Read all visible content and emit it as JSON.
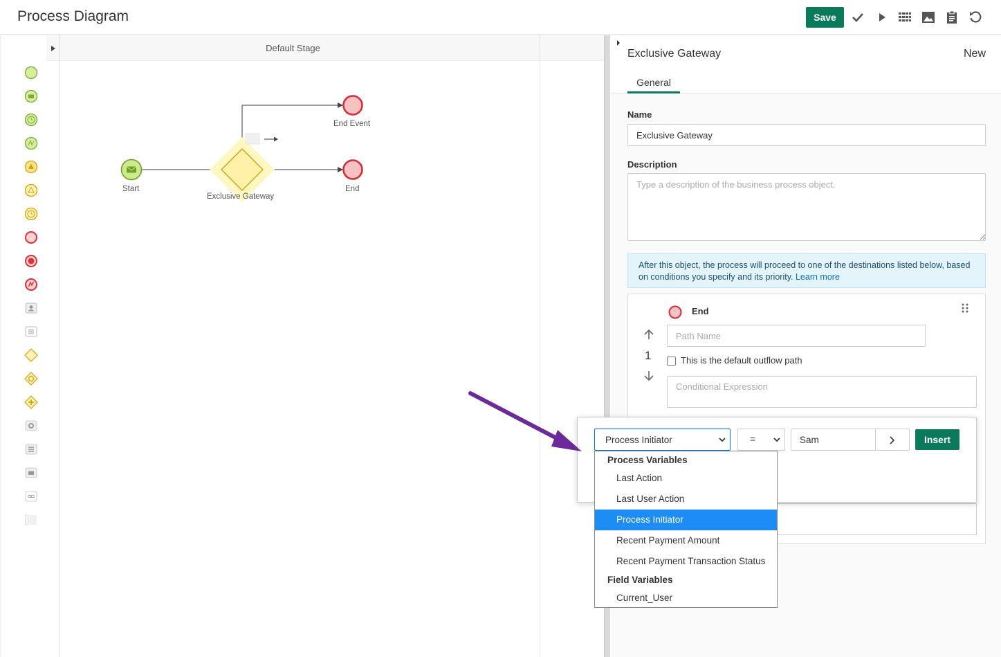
{
  "header": {
    "title": "Process Diagram",
    "save_label": "Save"
  },
  "stage": {
    "title": "Default Stage"
  },
  "diagram": {
    "labels": {
      "start": "Start",
      "gateway": "Exclusive Gateway",
      "end_event": "End Event",
      "end": "End"
    }
  },
  "panel": {
    "title": "Exclusive Gateway",
    "status": "New",
    "tab_general": "General",
    "name_label": "Name",
    "name_value": "Exclusive Gateway",
    "description_label": "Description",
    "description_placeholder": "Type a description of the business process object.",
    "info_text": "After this object, the process will proceed to one of the destinations listed below, based on conditions you specify and its priority.",
    "info_link": "Learn more",
    "path": {
      "target": "End",
      "priority": "1",
      "path_name_placeholder": "Path Name",
      "default_checkbox_label": "This is the default outflow path",
      "conditional_placeholder": "Conditional Expression"
    }
  },
  "popover": {
    "variable_select": "Process Initiator",
    "operator_select": "=",
    "value_input": "Sam",
    "insert_label": "Insert"
  },
  "dropdown": {
    "group1": "Process Variables",
    "group1_options": [
      "Last Action",
      "Last User Action",
      "Process Initiator",
      "Recent Payment Amount",
      "Recent Payment Transaction Status"
    ],
    "group2": "Field Variables",
    "group2_options": [
      "Current_User"
    ],
    "selected": "Process Initiator"
  },
  "colors": {
    "brand_green": "#0b7a5b",
    "selected_blue": "#1e8cf5",
    "annotation_purple": "#6a2a9a"
  }
}
